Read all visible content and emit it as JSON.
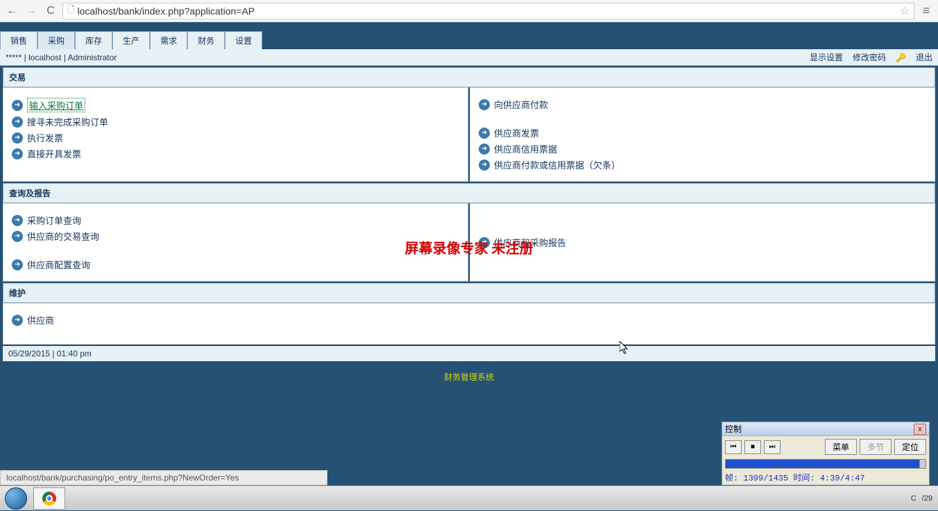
{
  "browser": {
    "url": "localhost/bank/index.php?application=AP"
  },
  "tabs": [
    "销售",
    "采购",
    "库存",
    "生产",
    "需求",
    "财务",
    "设置"
  ],
  "active_tab_index": 1,
  "header": {
    "left": "***** | localhost | Administrator",
    "links": {
      "display": "显示设置",
      "password": "修改密码",
      "exit": "退出"
    }
  },
  "sections": {
    "transaction": {
      "title": "交易",
      "left": [
        {
          "label": "输入采购订单",
          "hl": true
        },
        {
          "label": "搜寻未完成采购订单"
        },
        {
          "label": "执行发票"
        },
        {
          "label": "直接开具发票"
        }
      ],
      "right_top": [
        {
          "label": "向供应商付款"
        }
      ],
      "right_bottom": [
        {
          "label": "供应商发票"
        },
        {
          "label": "供应商信用票据"
        },
        {
          "label": "供应商付款或信用票据（欠条）"
        }
      ]
    },
    "query": {
      "title": "查询及报告",
      "left_top": [
        {
          "label": "采购订单查询"
        },
        {
          "label": "供应商的交易查询"
        }
      ],
      "left_bottom": [
        {
          "label": "供应商配置查询"
        }
      ],
      "right": [
        {
          "label": "供应商和采购报告"
        }
      ]
    },
    "maintain": {
      "title": "维护",
      "left": [
        {
          "label": "供应商"
        }
      ]
    }
  },
  "datetime": "05/29/2015 | 01:40 pm",
  "footer_link": "财务管理系统",
  "watermark": "屏幕录像专家  未注册",
  "status_bar": "localhost/bank/purchasing/po_entry_items.php?NewOrder=Yes",
  "control_window": {
    "title": "控制",
    "buttons": {
      "menu": "菜单",
      "multi": "多节",
      "locate": "定位"
    },
    "info": "帧: 1399/1435 时间: 4:39/4:47"
  },
  "tray": {
    "clock": "/29",
    "c": "C"
  }
}
